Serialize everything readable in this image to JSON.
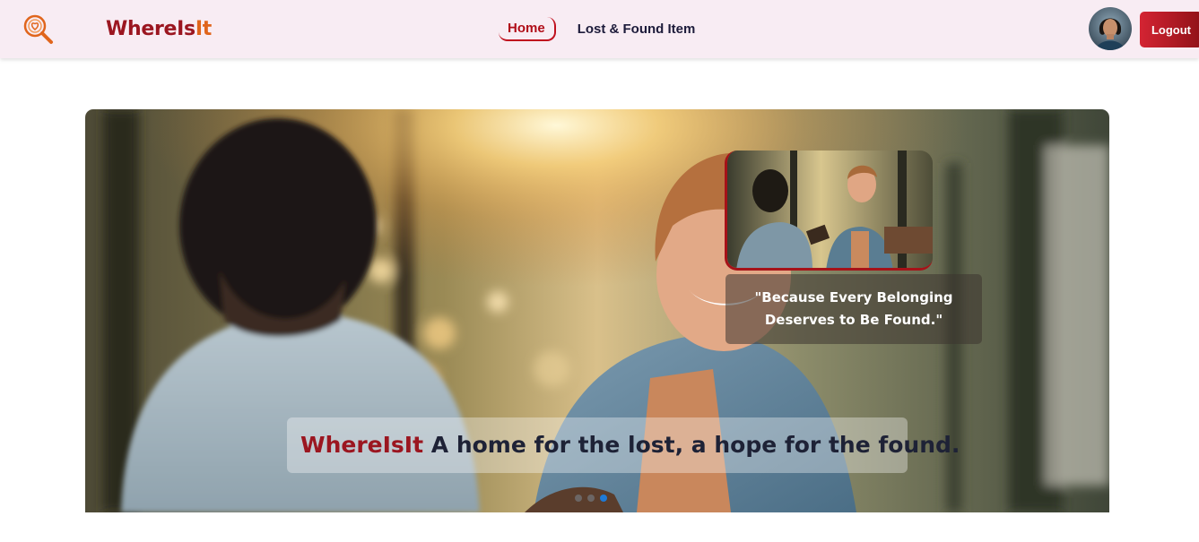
{
  "navbar": {
    "brand_part1": "WhereIs",
    "brand_part2": "It",
    "logo_icon": "magnifier-heart-icon",
    "links": [
      {
        "label": "Home",
        "active": true
      },
      {
        "label": "Lost & Found Item",
        "active": false
      }
    ],
    "logout_label": "Logout"
  },
  "hero": {
    "quote_line1": "\"Because Every Belonging",
    "quote_line2": "Deserves to Be Found.\"",
    "caption_brand": "WhereIsIt",
    "caption_text": "A home for the lost, a hope for the found.",
    "slides": 3,
    "active_slide": 3
  },
  "colors": {
    "brand_dark_red": "#9b1620",
    "brand_orange": "#e0651c",
    "nav_bg": "#f8ecf3",
    "logout_start": "#d42433",
    "logout_end": "#8f1117",
    "dot_active": "#1f7ad6"
  }
}
